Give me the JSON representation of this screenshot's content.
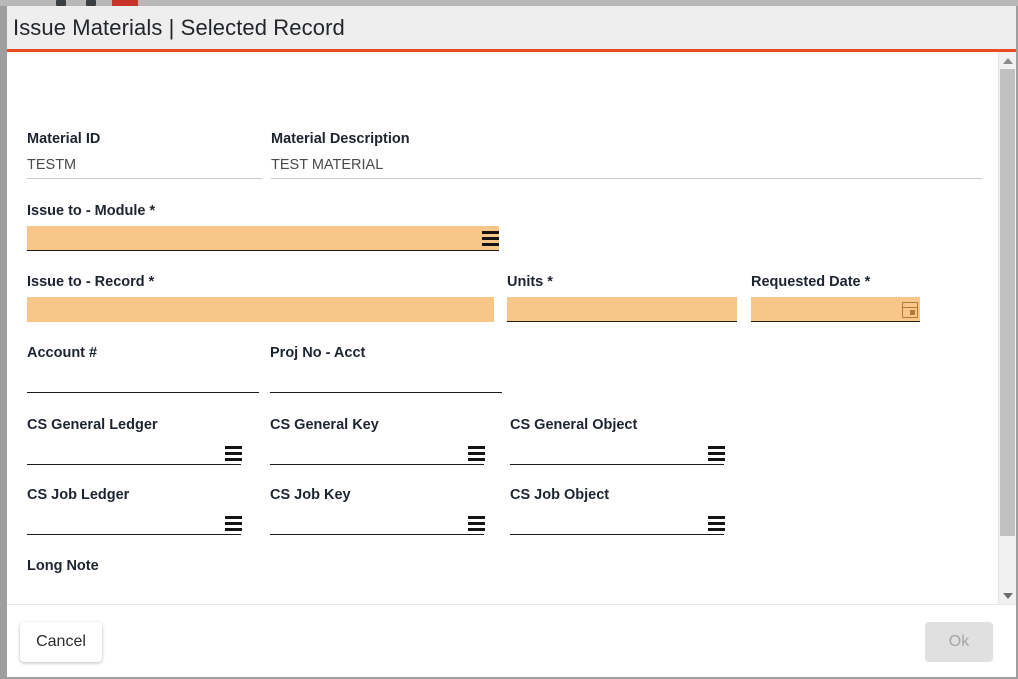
{
  "window": {
    "title": "Issue Materials | Selected Record",
    "accent_color": "#e8491d",
    "header_bg": "#eeeeee",
    "required_field_color": "#f9c68a"
  },
  "form": {
    "fields": [
      {
        "key": "material_id",
        "label": "Material ID",
        "value": "TESTM",
        "type": "readonly",
        "required": false
      },
      {
        "key": "material_description",
        "label": "Material Description",
        "value": "TEST MATERIAL",
        "type": "readonly",
        "required": false
      },
      {
        "key": "issue_to_module",
        "label": "Issue to - Module *",
        "value": "",
        "type": "lookup",
        "required": true
      },
      {
        "key": "issue_to_record",
        "label": "Issue to - Record *",
        "value": "",
        "type": "text",
        "required": true
      },
      {
        "key": "units",
        "label": "Units *",
        "value": "",
        "type": "text",
        "required": true
      },
      {
        "key": "requested_date",
        "label": "Requested Date *",
        "value": "",
        "type": "date",
        "required": true
      },
      {
        "key": "account_number",
        "label": "Account #",
        "value": "",
        "type": "text",
        "required": false
      },
      {
        "key": "proj_no_acct",
        "label": "Proj No - Acct",
        "value": "",
        "type": "text",
        "required": false
      },
      {
        "key": "cs_general_ledger",
        "label": "CS General Ledger",
        "value": "",
        "type": "lookup",
        "required": false
      },
      {
        "key": "cs_general_key",
        "label": "CS General Key",
        "value": "",
        "type": "lookup",
        "required": false
      },
      {
        "key": "cs_general_object",
        "label": "CS General Object",
        "value": "",
        "type": "lookup",
        "required": false
      },
      {
        "key": "cs_job_ledger",
        "label": "CS Job Ledger",
        "value": "",
        "type": "lookup",
        "required": false
      },
      {
        "key": "cs_job_key",
        "label": "CS Job Key",
        "value": "",
        "type": "lookup",
        "required": false
      },
      {
        "key": "cs_job_object",
        "label": "CS Job Object",
        "value": "",
        "type": "lookup",
        "required": false
      },
      {
        "key": "long_note",
        "label": "Long Note",
        "value": "",
        "type": "text",
        "required": false
      }
    ]
  },
  "footer": {
    "cancel_label": "Cancel",
    "ok_label": "Ok",
    "ok_enabled": false
  },
  "scrollbar": {
    "up_arrow": "scroll-up-arrow",
    "down_arrow": "scroll-down-arrow"
  }
}
